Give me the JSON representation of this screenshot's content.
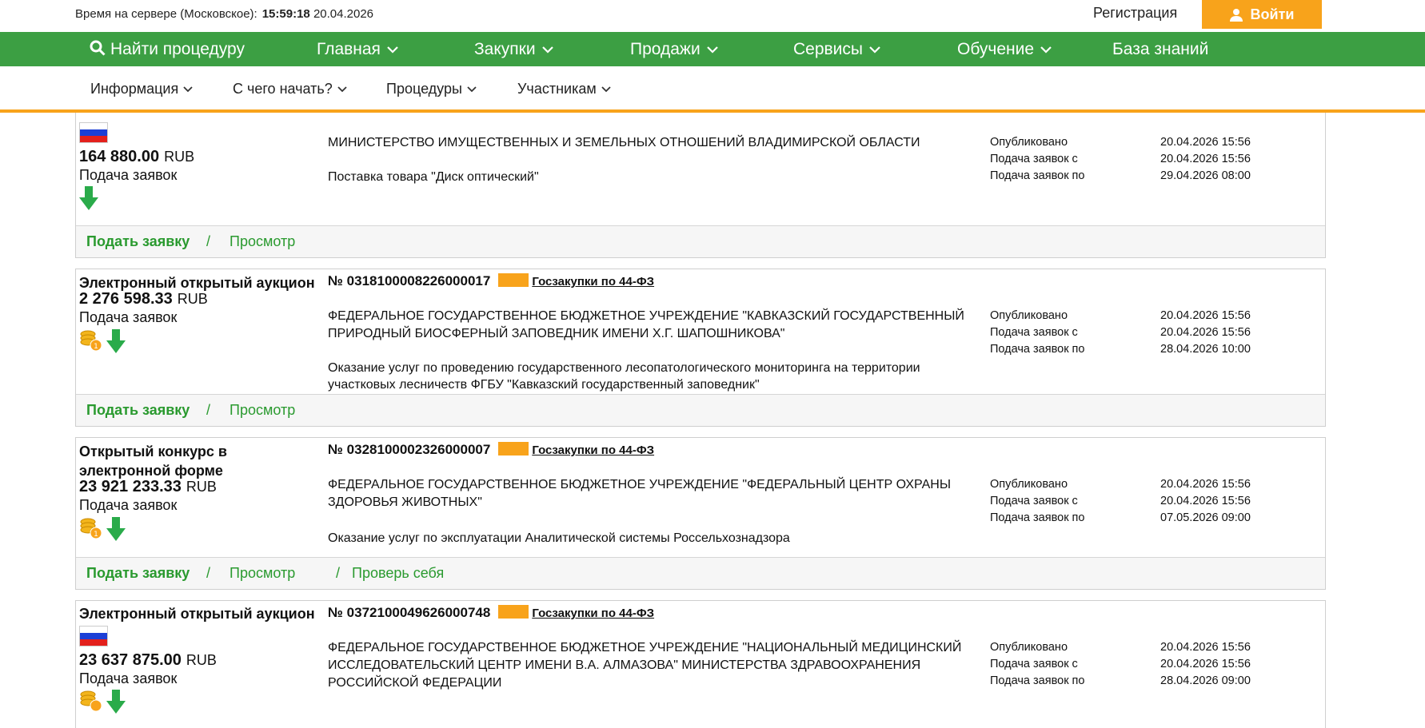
{
  "header": {
    "server_time_label": "Время на сервере (Московское):",
    "server_time": "15:59:18",
    "server_date": "20.04.2026",
    "register_label": "Регистрация",
    "login_label": "Войти"
  },
  "colors": {
    "green": "#3c9f43",
    "orange": "#f8a31b",
    "link_green": "#2a9a2f"
  },
  "nav": {
    "search_label": "Найти процедуру",
    "items": [
      "Главная",
      "Закупки",
      "Продажи",
      "Сервисы",
      "Обучение",
      "База знаний"
    ]
  },
  "subnav": {
    "items": [
      "Информация",
      "С чего начать?",
      "Процедуры",
      "Участникам"
    ]
  },
  "labels": {
    "apply": "Подать заявку",
    "sep": "/",
    "view": "Просмотр",
    "check": "Проверь себя",
    "published": "Опубликовано",
    "from": "Подача заявок с",
    "to": "Подача заявок по",
    "stage": "Подача заявок",
    "currency": "RUB",
    "law": "Госзакупки по 44-ФЗ"
  },
  "procedures": [
    {
      "price": "164 880.00",
      "org": "МИНИСТЕРСТВО ИМУЩЕСТВЕННЫХ И ЗЕМЕЛЬНЫХ ОТНОШЕНИЙ ВЛАДИМИРСКОЙ ОБЛАСТИ",
      "subject": "Поставка товара \"Диск оптический\"",
      "published": "20.04.2026 15:56",
      "from": "20.04.2026 15:56",
      "to": "29.04.2026 08:00"
    },
    {
      "type": "Электронный открытый аукцион",
      "number": "№ 0318100008226000017",
      "price": "2 276 598.33",
      "org": "ФЕДЕРАЛЬНОЕ ГОСУДАРСТВЕННОЕ БЮДЖЕТНОЕ УЧРЕЖДЕНИЕ \"КАВКАЗСКИЙ ГОСУДАРСТВЕННЫЙ ПРИРОДНЫЙ БИОСФЕРНЫЙ ЗАПОВЕДНИК ИМЕНИ Х.Г. ШАПОШНИКОВА\"",
      "subject": "Оказание услуг по проведению государственного лесопатологического мониторинга на территории участковых лесничеств ФГБУ \"Кавказский государственный заповедник\"",
      "published": "20.04.2026 15:56",
      "from": "20.04.2026 15:56",
      "to": "28.04.2026 10:00"
    },
    {
      "type": "Открытый конкурс в электронной форме",
      "number": "№ 0328100002326000007",
      "price": "23 921 233.33",
      "org": "ФЕДЕРАЛЬНОЕ ГОСУДАРСТВЕННОЕ БЮДЖЕТНОЕ УЧРЕЖДЕНИЕ \"ФЕДЕРАЛЬНЫЙ ЦЕНТР ОХРАНЫ ЗДОРОВЬЯ ЖИВОТНЫХ\"",
      "subject": "Оказание услуг по эксплуатации Аналитической системы Россельхознадзора",
      "published": "20.04.2026 15:56",
      "from": "20.04.2026 15:56",
      "to": "07.05.2026 09:00"
    },
    {
      "type": "Электронный открытый аукцион",
      "number": "№ 0372100049626000748",
      "price": "23 637 875.00",
      "org": "ФЕДЕРАЛЬНОЕ ГОСУДАРСТВЕННОЕ БЮДЖЕТНОЕ УЧРЕЖДЕНИЕ \"НАЦИОНАЛЬНЫЙ МЕДИЦИНСКИЙ ИССЛЕДОВАТЕЛЬСКИЙ ЦЕНТР ИМЕНИ В.А. АЛМАЗОВА\" МИНИСТЕРСТВА ЗДРАВООХРАНЕНИЯ РОССИЙСКОЙ ФЕДЕРАЦИИ",
      "published": "20.04.2026 15:56",
      "from": "20.04.2026 15:56",
      "to": "28.04.2026 09:00"
    }
  ]
}
